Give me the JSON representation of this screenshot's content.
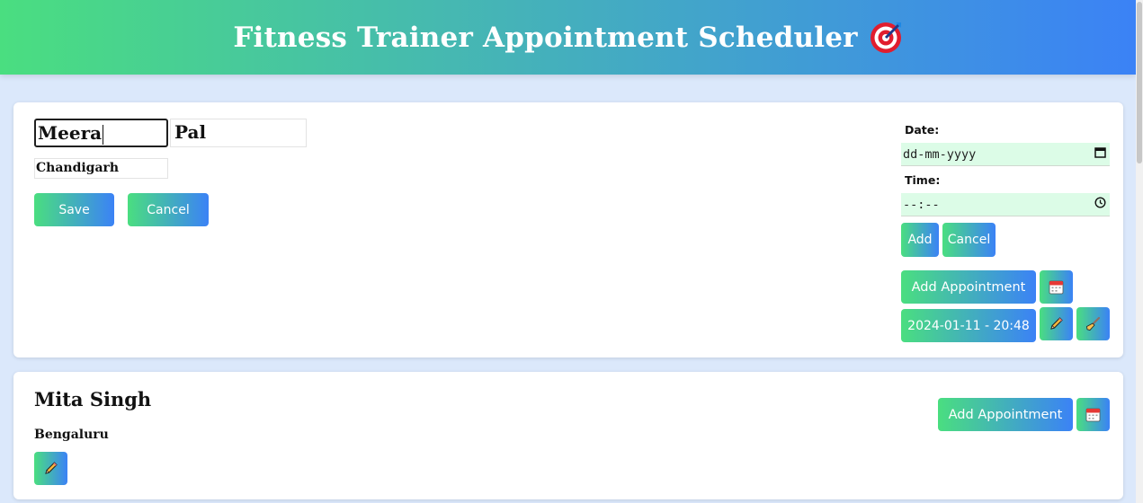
{
  "header": {
    "title": "Fitness Trainer Appointment Scheduler",
    "icon": "target-icon"
  },
  "trainers": [
    {
      "mode": "editing",
      "first_name": "Meera",
      "last_name": "Pal",
      "city": "Chandigarh",
      "save_label": "Save",
      "cancel_label": "Cancel",
      "date_label": "Date:",
      "date_placeholder": "dd-mm-yyyy",
      "time_label": "Time:",
      "time_placeholder": "--:--",
      "add_label": "Add",
      "cancel_appt_label": "Cancel",
      "add_appointment_label": "Add Appointment",
      "appointments": [
        "2024-01-11 - 20:48"
      ]
    },
    {
      "mode": "view",
      "name": "Mita Singh",
      "city": "Bengaluru",
      "add_appointment_label": "Add Appointment"
    }
  ],
  "colors": {
    "gradient_start": "#4ade80",
    "gradient_end": "#3b82f6",
    "picker_bg": "#dcfce7",
    "page_bg": "#dbe8fb"
  }
}
